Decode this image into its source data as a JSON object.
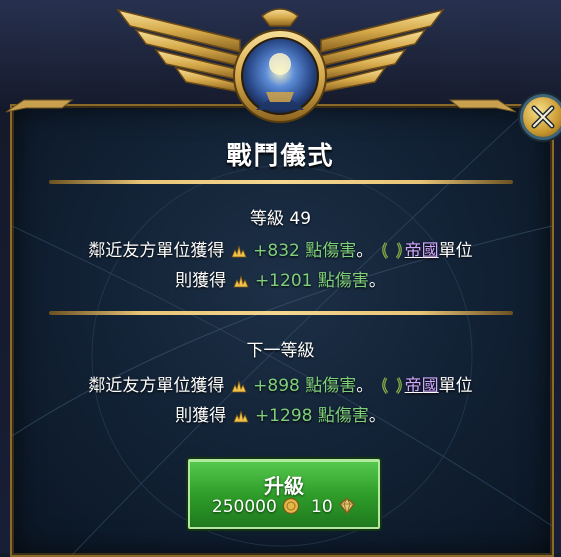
{
  "title": "戰鬥儀式",
  "current": {
    "heading": "等級 49",
    "line1_prefix": "鄰近友方單位獲得",
    "line1_value": "+832 點傷害",
    "line1_punct": "。",
    "faction": "帝國",
    "line1_suffix": "單位",
    "line2_prefix": "則獲得",
    "line2_value": "+1201 點傷害",
    "line2_punct": "。"
  },
  "next": {
    "heading": "下一等級",
    "line1_prefix": "鄰近友方單位獲得",
    "line1_value": "+898 點傷害",
    "line1_punct": "。",
    "faction": "帝國",
    "line1_suffix": "單位",
    "line2_prefix": "則獲得",
    "line2_value": "+1298 點傷害",
    "line2_punct": "。"
  },
  "upgrade": {
    "label": "升級",
    "gold_cost": "250000",
    "gem_cost": "10"
  },
  "colors": {
    "accent_gold": "#e8c476",
    "value_green": "#7fd07a",
    "faction_purple": "#d2a8ff",
    "button_green": "#2f9e2a"
  },
  "icons": {
    "damage": "damage-burst-icon",
    "faction": "laurel-wreath-icon",
    "gold": "gold-coin-icon",
    "gem": "gem-icon",
    "close": "close-icon"
  }
}
